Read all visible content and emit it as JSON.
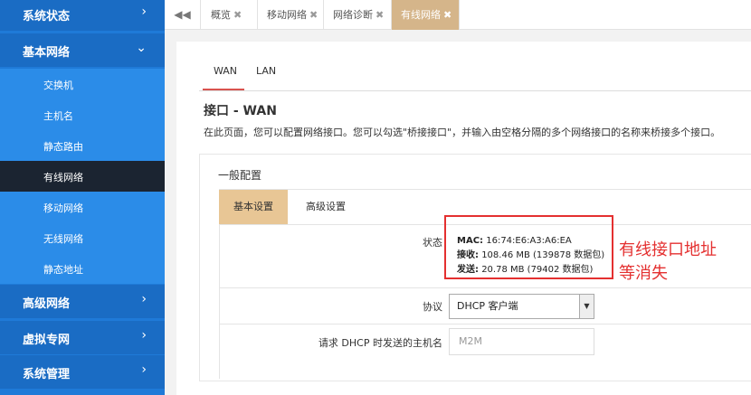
{
  "sidebar": {
    "status": "系统状态",
    "basic_network": "基本网络",
    "sub_items": [
      "交换机",
      "主机名",
      "静态路由",
      "有线网络",
      "移动网络",
      "无线网络",
      "静态地址"
    ],
    "advanced_network": "高级网络",
    "vpn": "虚拟专网",
    "system_management": "系统管理"
  },
  "page_tabs": {
    "prev_icon": "◀◀",
    "close_icon": "✖",
    "items": [
      "概览",
      "移动网络",
      "网络诊断",
      "有线网络"
    ],
    "active": "有线网络"
  },
  "interface_tabs": [
    "WAN",
    "LAN"
  ],
  "interface_title": "接口 - WAN",
  "description": "在此页面，您可以配置网络接口。您可以勾选\"桥接接口\"，并输入由空格分隔的多个网络接口的名称来桥接多个接口。",
  "general_config": {
    "title": "一般配置",
    "tabs": [
      "基本设置",
      "高级设置"
    ],
    "status_label": "状态",
    "status": {
      "mac_label": "MAC:",
      "mac_value": "16:74:E6:A3:A6:EA",
      "rx_label": "接收:",
      "rx_value": "108.46 MB (139878 数据包)",
      "tx_label": "发送:",
      "tx_value": "20.78 MB (79402 数据包)"
    },
    "protocol_label": "协议",
    "protocol_value": "DHCP 客户端",
    "hostname_label": "请求 DHCP 时发送的主机名",
    "hostname_placeholder": "M2M"
  },
  "annotation": {
    "line1": "有线接口地址",
    "line2": "等消失",
    "color": "#e43030"
  },
  "colors": {
    "sidebar": "#1f7ad8",
    "sidebar_active": "#1b2431",
    "tab_active": "#d5b58a"
  }
}
